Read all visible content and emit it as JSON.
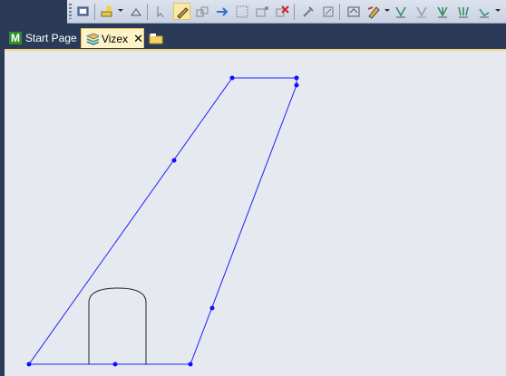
{
  "toolbar": {
    "icons": [
      "properties-icon",
      "new-layer-icon",
      "dropdown-caret",
      "layer-up-icon",
      "select-icon",
      "edit-object-icon",
      "copy-object-icon",
      "move-object-icon",
      "group-object-icon",
      "split-object-icon",
      "delete-object-icon",
      "tools-icon",
      "tools-2-icon",
      "attribute-icon",
      "style-icon",
      "dropdown-caret",
      "digitise-icon",
      "digitise-2-icon",
      "digitise-3-icon",
      "digitise-4-icon",
      "digitise-5-icon",
      "dropdown-caret"
    ]
  },
  "tabs": [
    {
      "label": "Start Page",
      "icon": "m-logo-icon"
    },
    {
      "label": "Vizex",
      "icon": "layers-icon",
      "close": "✕"
    },
    {
      "label": "",
      "icon": "folder-icon"
    }
  ],
  "colors": {
    "outline": "#1f1fff",
    "vertex": "#1010ff",
    "drive": "#222222"
  }
}
